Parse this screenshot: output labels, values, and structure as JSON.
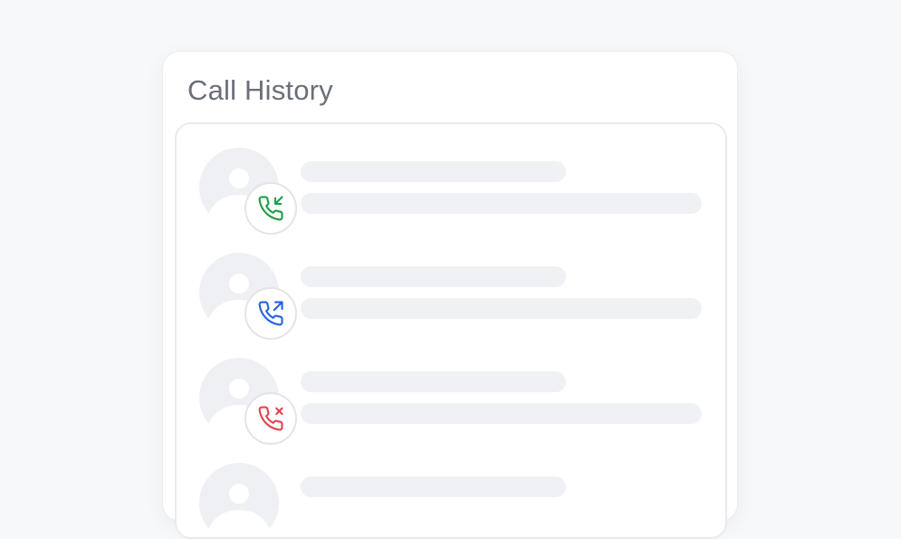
{
  "header": {
    "title": "Call History"
  },
  "calls": [
    {
      "type": "incoming",
      "icon": "phone-incoming-icon",
      "color": "#1e9e48"
    },
    {
      "type": "outgoing",
      "icon": "phone-outgoing-icon",
      "color": "#2463e0"
    },
    {
      "type": "missed",
      "icon": "phone-missed-icon",
      "color": "#e2434f"
    },
    {
      "type": "unknown",
      "icon": "avatar-placeholder-icon",
      "color": "#c9ccd3"
    }
  ],
  "colors": {
    "page_background": "#f7f8fa",
    "card_background": "#ffffff",
    "title_text": "#6b6f78",
    "skeleton": "#f0f1f4",
    "avatar_background": "#eff0f3",
    "avatar_figure": "#ffffff"
  }
}
